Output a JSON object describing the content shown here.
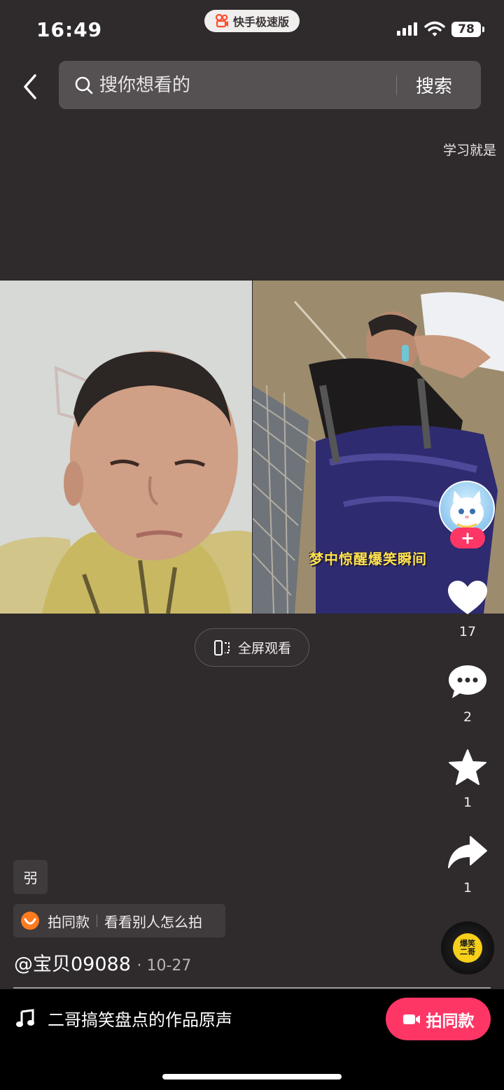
{
  "status_bar": {
    "time": "16:49",
    "app_name": "快手极速版",
    "battery": "78"
  },
  "search": {
    "placeholder": "搜你想看的",
    "button_label": "搜索"
  },
  "marquee_text": "学习就是",
  "video": {
    "caption": "梦中惊醒爆笑瞬间",
    "fullscreen_label": "全屏观看"
  },
  "rail": {
    "likes": "17",
    "comments": "2",
    "favorites": "1",
    "shares": "1",
    "follow_symbol": "+",
    "disc_text_top": "爆笑",
    "disc_text_bottom": "二哥"
  },
  "info": {
    "tag": "弜",
    "same_style_label": "拍同款",
    "see_others_label": "看看别人怎么拍",
    "author": "@宝贝09088",
    "date": "10-27"
  },
  "bottom": {
    "music_title": "二哥搞笑盘点的作品原声",
    "shoot_label": "拍同款"
  },
  "colors": {
    "background": "#2f2a2b",
    "accent": "#fe3666",
    "caption_yellow": "#ffe14d"
  }
}
